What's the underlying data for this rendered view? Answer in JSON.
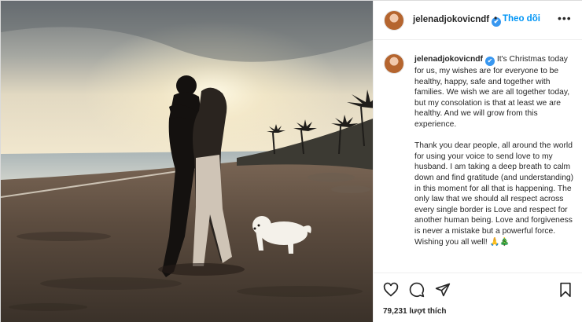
{
  "post": {
    "username": "jelenadjokovicndf",
    "verified_glyph": "✔",
    "separator": "•",
    "follow_label": "Theo dõi",
    "more_glyph": "•••",
    "caption_username": "jelenadjokovicndf",
    "caption_paragraphs": [
      "It's Christmas today for us, my wishes are for everyone to be healthy, happy, safe and together with families. We wish we are all together today, but my consolation is that at least we are healthy. And we will grow from this experience.",
      "Thank you dear people, all around the world for using your voice to send love to my husband. I am taking a deep breath to calm down and find gratitude (and understanding) in this moment for all that is happening. The only law that we should all respect across every single border is Love and respect for another human being. Love and forgiveness is never a mistake but a powerful force. Wishing you all well! 🙏🎄"
    ],
    "likes": "79,231 lượt thích"
  },
  "icons": {
    "like": "heart-icon",
    "comment": "comment-icon",
    "share": "send-icon",
    "save": "bookmark-icon"
  },
  "colors": {
    "accent": "#0095f6",
    "verified": "#3897f0",
    "text": "#262626"
  }
}
